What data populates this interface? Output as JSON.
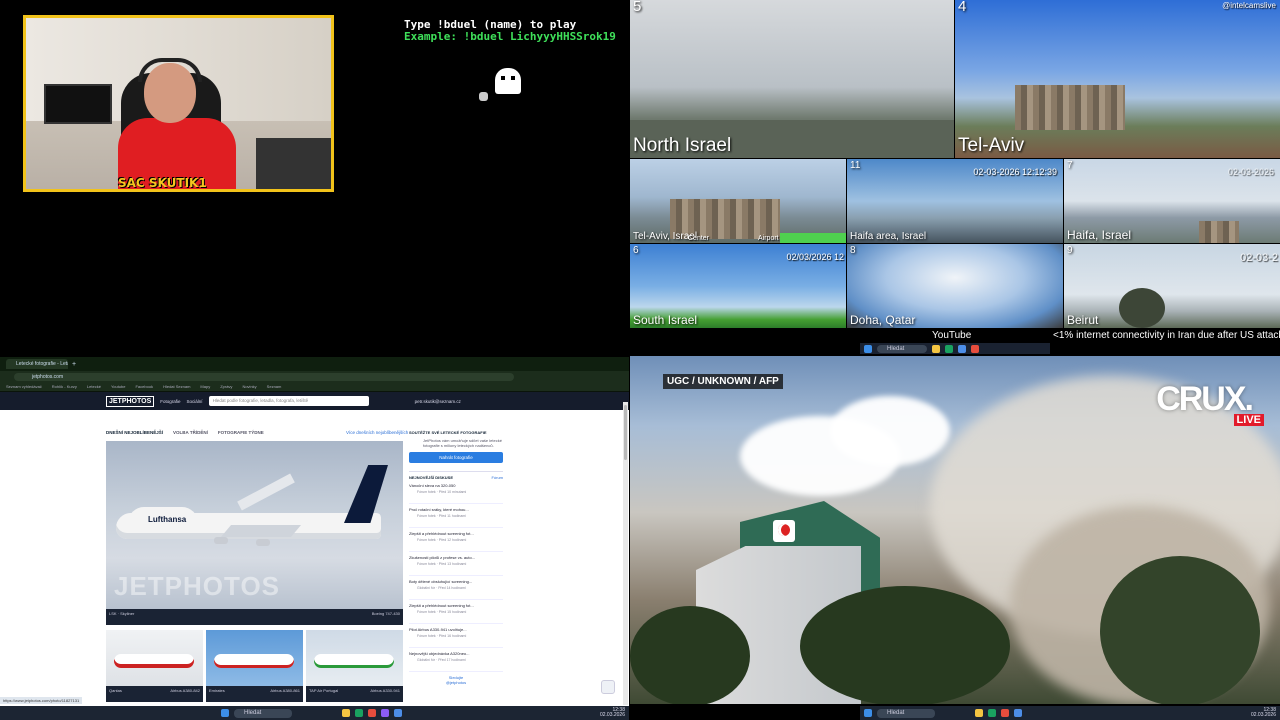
{
  "stream": {
    "webcam_name": "SAC SKUTIK1",
    "game_prompt_line1": "Type !bduel (name) to play",
    "game_prompt_line2": "Example: !bduel LichyyyHHSSrok19"
  },
  "cams": {
    "watermark": "@intelcamslive",
    "tiles": [
      {
        "num": "5",
        "label": "North Israel"
      },
      {
        "num": "4",
        "label": "Tel-Aviv"
      },
      {
        "num": "",
        "label": "Tel-Aviv, Israel",
        "extra1": "Center",
        "extra2": "Airport"
      },
      {
        "num": "11",
        "label": "Haifa area, Israel",
        "timestamp": "02-03-2026 12:12:39"
      },
      {
        "num": "7",
        "label": "Haifa, Israel",
        "timestamp": "02-03-2026"
      },
      {
        "num": "6",
        "label": "South Israel",
        "timestamp": "02/03/2026 12"
      },
      {
        "num": "8",
        "label": "Doha, Qatar"
      },
      {
        "num": "9",
        "label": "Beirut",
        "timestamp": "02-03-2"
      }
    ],
    "ticker_source": "YouTube",
    "ticker_text": "<1% internet connectivity in Iran due after US attack"
  },
  "browser": {
    "tab_title": "Letecké fotografie - Letadl...",
    "url": "jetphotos.com",
    "bookmarks": [
      "Seznam vyhledávač",
      "Rohlík - Kurzy",
      "Letecké",
      "Youtube",
      "Facebook",
      "Hledat Seznam",
      "Mapy",
      "Zprávy",
      "Novinky",
      "Seznam"
    ],
    "status_url": "https://www.jetphotos.com/photo/11827131"
  },
  "jetphotos": {
    "logo": "JETPHOTOS",
    "nav_photos": "Fotografie",
    "nav_more": "Sociální",
    "search_placeholder": "Hledat podle fotografie, letadla, fotografa, letiště",
    "user": "petr.skutik@seznam.cz",
    "tab_today": "DNEŠNÍ NEJOBLÍBENĚJŠÍ",
    "tab_fresh": "VOLBA TŘÍDĚNÍ",
    "tab_week": "FOTOGRAFIE TÝDNE",
    "show_all": "Více dnešních nejoblíbenějších",
    "hero_watermark": "JETPHOTOS",
    "hero_airline": "Lufthansa",
    "hero_caption_left": "LSK · Skyliner",
    "hero_caption_right": "Boeing 747-430",
    "thumbs": [
      {
        "left": "Qantas",
        "right": "Airbus A380-842"
      },
      {
        "left": "Emirates",
        "right": "Airbus A380-861"
      },
      {
        "left": "TAP Air Portugal",
        "right": "Airbus A330-941"
      }
    ],
    "sidebar_title": "SOUTĚŽTE SVÉ LETECKÉ FOTOGRAFIE",
    "sidebar_text": "JetPhotos vám umožňuje sdílet vaše letecké fotografie s miliony leteckých nadšenců.",
    "upload_button": "Nahrát fotografie",
    "discussions_title": "NEJNOVĚJŠÍ DISKUSE",
    "discussions_more": "Fórum",
    "discussions": [
      {
        "title": "Vánoční sleva na 320-050",
        "meta": "Fórum fotek · Před 10 minutami"
      },
      {
        "title": "Proč rotační sráky, které mohou...",
        "meta": "Fórum fotek · Před 11 hodinami"
      },
      {
        "title": "Zlepšit a přehlédnout screening fot...",
        "meta": "Fórum fotek · Před 12 hodinami"
      },
      {
        "title": "Zkušenosti pilotů z profese vs. auto...",
        "meta": "Fórum fotek · Před 13 hodinami"
      },
      {
        "title": "Boty dělené obsluhující screening...",
        "meta": "Globální fór · Před 14 hodinami"
      },
      {
        "title": "Zlepšit a přehlédnout screening fot...",
        "meta": "Fórum fotek · Před 15 hodinami"
      },
      {
        "title": "Pilot Airbus A330-941 uvolňuje...",
        "meta": "Fórum fotek · Před 16 hodinami"
      },
      {
        "title": "Nejnovější objednávka A320neo...",
        "meta": "Globální fór · Před 17 hodinami"
      }
    ],
    "sidebar_footer_1": "Sledujte",
    "sidebar_footer_2": "@jetphotos"
  },
  "news": {
    "credit": "UGC / UNKNOWN / AFP",
    "brand": "CRUX.",
    "live": "LIVE"
  },
  "taskbars": {
    "search_label": "Hledat",
    "time": "12:38",
    "date": "02.03.2026"
  }
}
